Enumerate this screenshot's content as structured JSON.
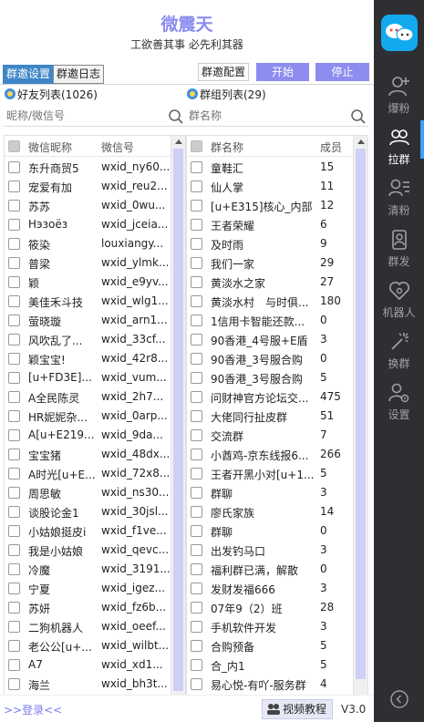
{
  "header": {
    "title": "微震天",
    "subtitle": "工欲善其事 必先利其器"
  },
  "tabs": [
    {
      "label": "群邀设置"
    },
    {
      "label": "群邀日志"
    }
  ],
  "toolbar": {
    "config_label": "群邀配置",
    "start_label": "开始",
    "stop_label": "停止"
  },
  "friends": {
    "title": "好友列表(1026)",
    "search_placeholder": "昵称/微信号",
    "col_name": "微信昵称",
    "col_id": "微信号",
    "rows": [
      {
        "name": "东升商贸5",
        "id": "wxid_ny60..."
      },
      {
        "name": "宠爱有加",
        "id": "wxid_reu2..."
      },
      {
        "name": "苏苏",
        "id": "wxid_0wu..."
      },
      {
        "name": "Нэзоёз",
        "id": "wxid_jceia..."
      },
      {
        "name": "筱染",
        "id": "louxiangy..."
      },
      {
        "name": "普梁",
        "id": "wxid_ylmk..."
      },
      {
        "name": "颖",
        "id": "wxid_e9yv..."
      },
      {
        "name": "美佳禾斗技",
        "id": "wxid_wlg1..."
      },
      {
        "name": "萤晓璇",
        "id": "wxid_arn1..."
      },
      {
        "name": "风吹乱了...",
        "id": "wxid_33cf..."
      },
      {
        "name": "颖宝宝!",
        "id": "wxid_42r8..."
      },
      {
        "name": "[u+FD3E]...",
        "id": "wxid_vum..."
      },
      {
        "name": "A全民陈灵",
        "id": "wxid_2h7..."
      },
      {
        "name": "HR妮妮杂...",
        "id": "wxid_0arp..."
      },
      {
        "name": "A[u+E219...",
        "id": "wxid_9da..."
      },
      {
        "name": "宝宝猪",
        "id": "wxid_48dx..."
      },
      {
        "name": "A时光[u+E...",
        "id": "wxid_72x8..."
      },
      {
        "name": "周思敏",
        "id": "wxid_ns30..."
      },
      {
        "name": "谈股论金1",
        "id": "wxid_30jsl..."
      },
      {
        "name": "小姑娘挺皮i",
        "id": "wxid_f1ve..."
      },
      {
        "name": "我是小姑娘",
        "id": "wxid_qevc..."
      },
      {
        "name": "冷魔",
        "id": "wxid_3191..."
      },
      {
        "name": "宁夏",
        "id": "wxid_igez..."
      },
      {
        "name": "苏妍",
        "id": "wxid_fz6b..."
      },
      {
        "name": "二狗机器人",
        "id": "wxid_oeef..."
      },
      {
        "name": "老公公[u+...",
        "id": "wxid_wilbt..."
      },
      {
        "name": "A7",
        "id": "wxid_xd1..."
      },
      {
        "name": "海兰",
        "id": "wxid_bh3t..."
      },
      {
        "name": "",
        "id": ""
      },
      {
        "name": "",
        "id": ""
      }
    ]
  },
  "groups": {
    "title": "群组列表(29)",
    "search_placeholder": "群名称",
    "col_name": "群名称",
    "col_members": "成员",
    "rows": [
      {
        "name": "童鞋汇",
        "members": "15"
      },
      {
        "name": "仙人掌",
        "members": "11"
      },
      {
        "name": "[u+E315]核心_内部",
        "members": "12"
      },
      {
        "name": "王者荣耀",
        "members": "6"
      },
      {
        "name": "及时雨",
        "members": "9"
      },
      {
        "name": "我们一家",
        "members": "29"
      },
      {
        "name": "黄淡水之家",
        "members": "27"
      },
      {
        "name": "黄淡水村　与时俱...",
        "members": "180"
      },
      {
        "name": "1信用卡智能还款...",
        "members": "0"
      },
      {
        "name": "90香港_4号服+E盾",
        "members": "3"
      },
      {
        "name": "90香港_3号服合购",
        "members": "0"
      },
      {
        "name": "90香港_3号服合购",
        "members": "5"
      },
      {
        "name": "问财神官方论坛交...",
        "members": "475"
      },
      {
        "name": "大佬同行扯皮群",
        "members": "51"
      },
      {
        "name": "交流群",
        "members": "7"
      },
      {
        "name": "小酋鸡-京东线报6...",
        "members": "266"
      },
      {
        "name": "王者开黑小对[u+1...",
        "members": "5"
      },
      {
        "name": "群聊",
        "members": "3"
      },
      {
        "name": "廖氏家族",
        "members": "14"
      },
      {
        "name": "群聊",
        "members": "0"
      },
      {
        "name": "出发钓马口",
        "members": "3"
      },
      {
        "name": "福利群已满，解散",
        "members": "0"
      },
      {
        "name": "发财发福666",
        "members": "3"
      },
      {
        "name": "07年9（2）班",
        "members": "28"
      },
      {
        "name": "手机软件开发",
        "members": "3"
      },
      {
        "name": "合购预备",
        "members": "5"
      },
      {
        "name": "合_内1",
        "members": "5"
      },
      {
        "name": "易心悦-有吖-服务群",
        "members": "4"
      },
      {
        "name": "",
        "members": ""
      },
      {
        "name": "",
        "members": ""
      }
    ]
  },
  "footer": {
    "login_label": ">>登录<<",
    "video_label": "视频教程",
    "version": "V3.0"
  },
  "sidebar": {
    "items": [
      {
        "label": "爆粉",
        "icon": "user-add-icon"
      },
      {
        "label": "拉群",
        "icon": "group-icon"
      },
      {
        "label": "清粉",
        "icon": "user-list-icon"
      },
      {
        "label": "群发",
        "icon": "broadcast-icon"
      },
      {
        "label": "机器人",
        "icon": "robot-icon"
      },
      {
        "label": "换群",
        "icon": "switch-icon"
      },
      {
        "label": "设置",
        "icon": "settings-user-icon"
      }
    ],
    "active_index": 1
  },
  "colors": {
    "accent": "#8d8df0",
    "tab_active": "#3d86c8",
    "sidebar_bg": "#2f2f33",
    "sidebar_active_bar": "#3aa3ff"
  },
  "scroll": {
    "friends_thumb_fraction": 0.95,
    "groups_thumb_fraction": 0.93
  }
}
